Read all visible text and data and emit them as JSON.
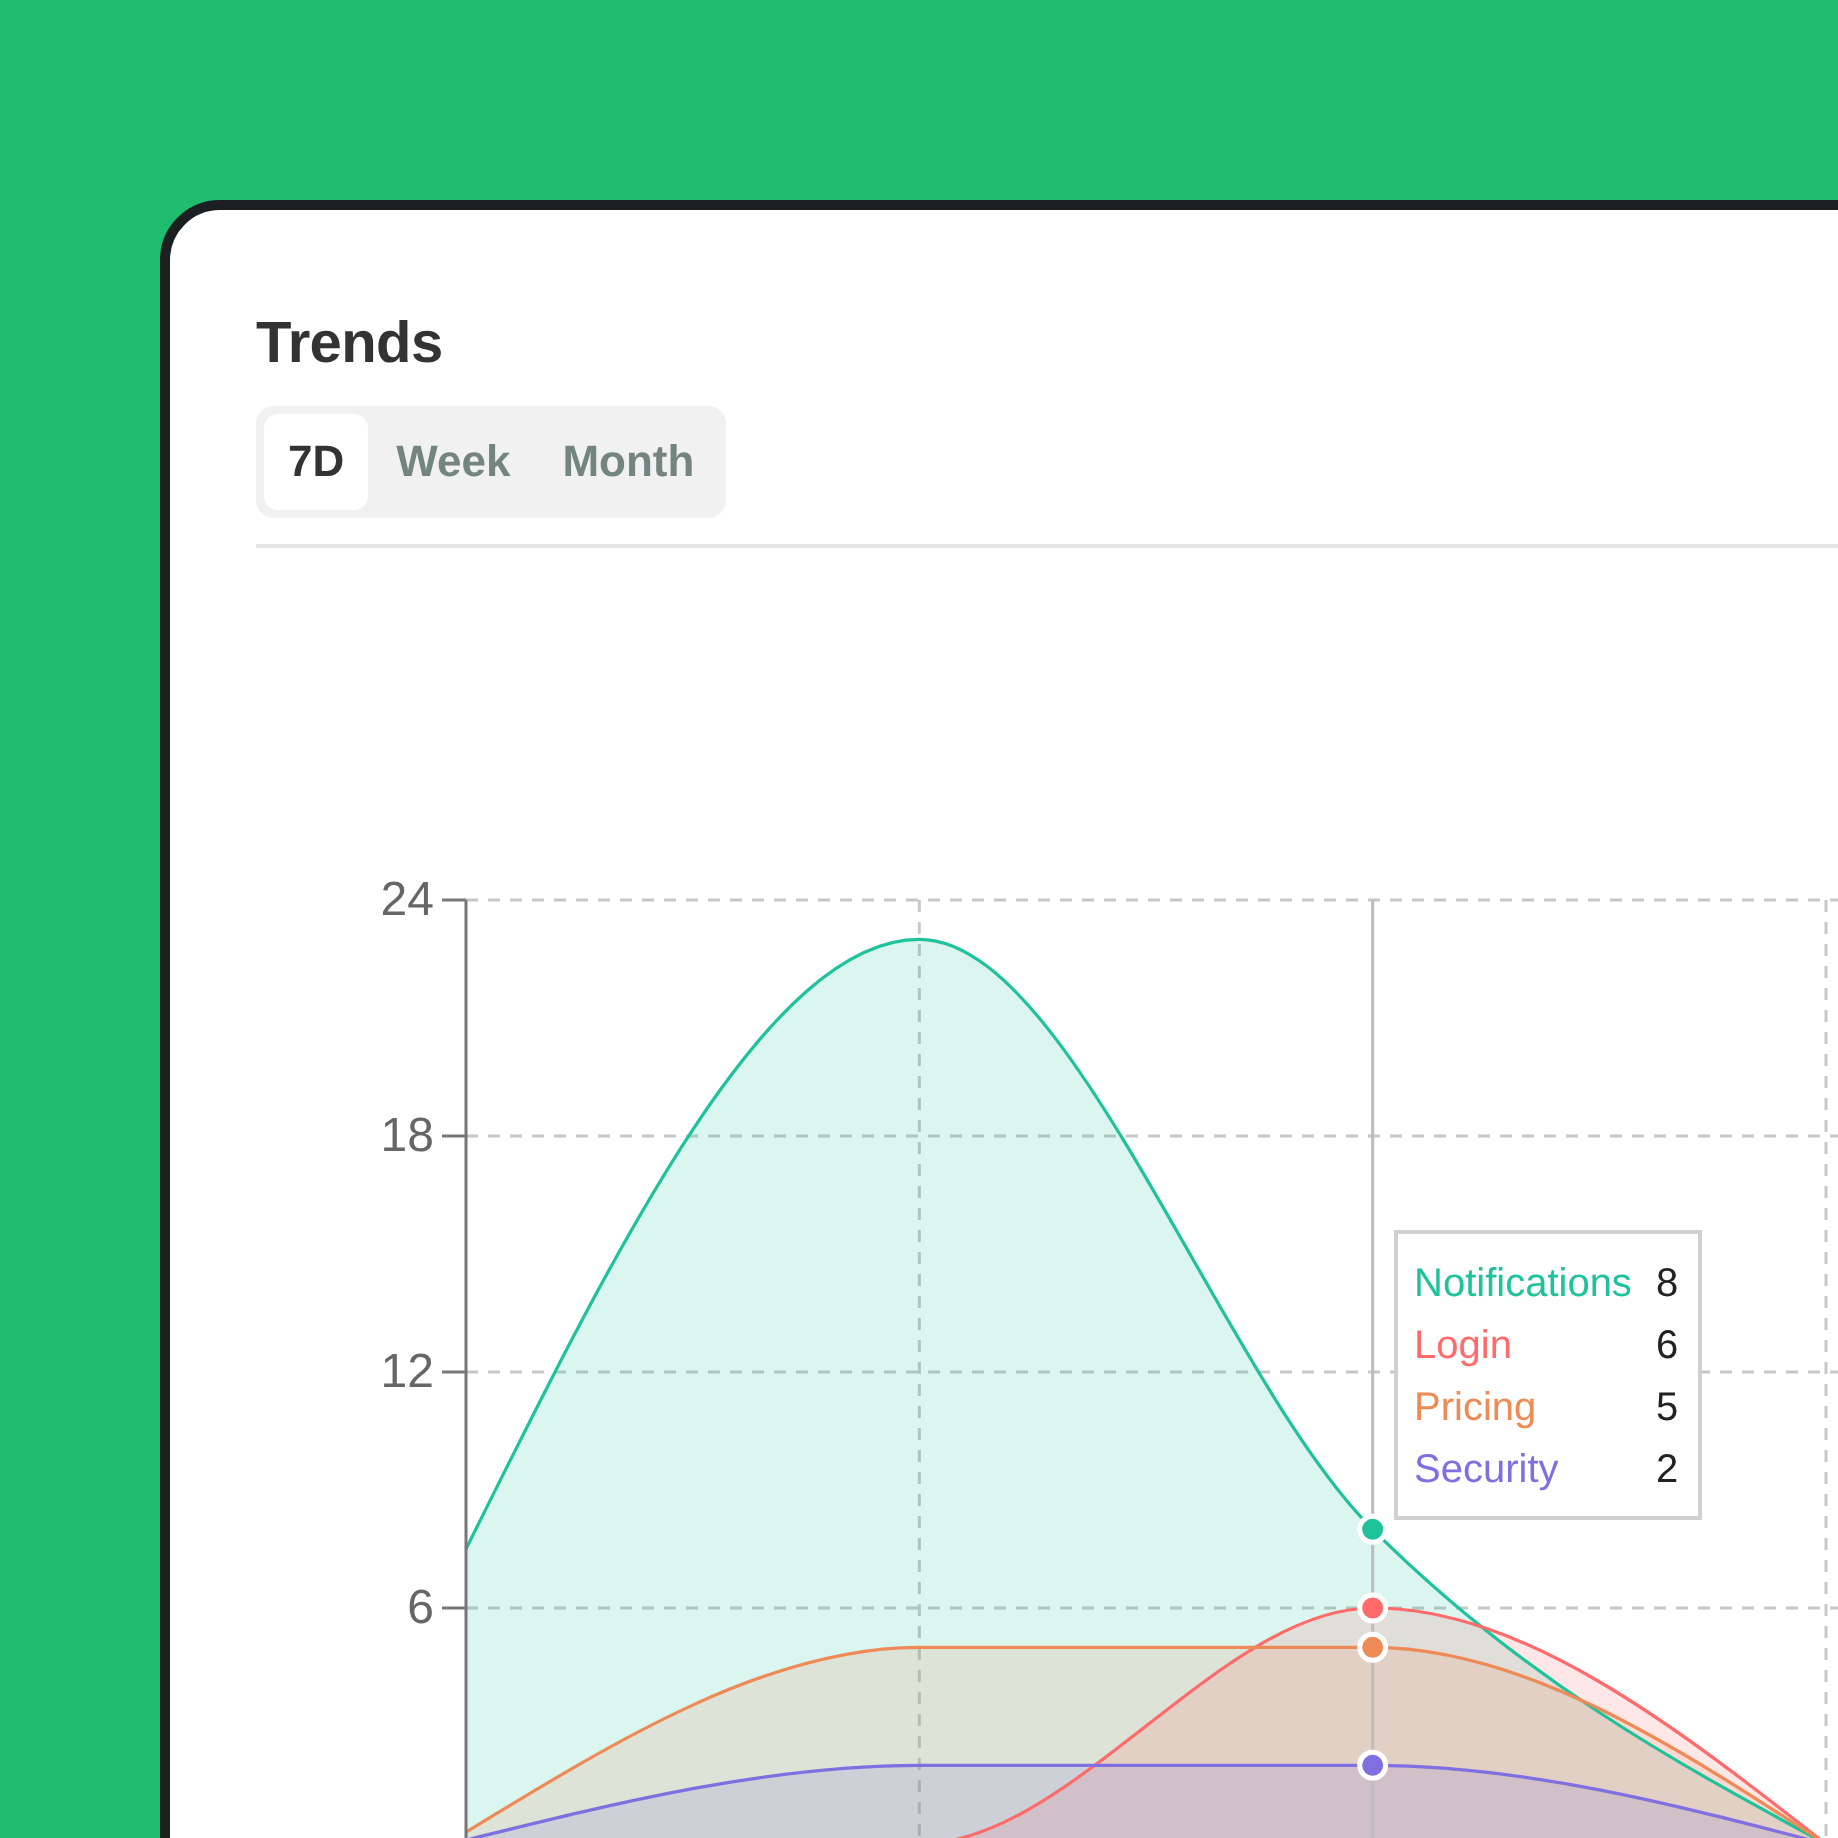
{
  "card": {
    "title": "Trends"
  },
  "tabs": [
    {
      "label": "7D",
      "selected": true
    },
    {
      "label": "Week",
      "selected": false
    },
    {
      "label": "Month",
      "selected": false
    }
  ],
  "chart": {
    "chart_data": {
      "type": "area",
      "stacked": false,
      "grid": true,
      "categories": [
        null,
        null,
        null,
        null
      ],
      "ylim": [
        0,
        24
      ],
      "yticks": [
        6,
        12,
        18,
        24
      ],
      "series": [
        {
          "name": "Notifications",
          "color": "#1ec29b",
          "values": [
            7.5,
            23,
            8,
            0
          ]
        },
        {
          "name": "Login",
          "color": "#ff6b6b",
          "values": [
            0,
            0,
            6,
            0
          ]
        },
        {
          "name": "Pricing",
          "color": "#ee8a55",
          "values": [
            0.3,
            5,
            5,
            0
          ]
        },
        {
          "name": "Security",
          "color": "#7f6fe0",
          "values": [
            0.1,
            2,
            2,
            0
          ]
        }
      ]
    },
    "hover_columns": [
      {
        "selected": false
      },
      {
        "selected": false
      },
      {
        "selected": true
      },
      {
        "selected": false
      }
    ],
    "tooltip": {
      "values": [
        "8",
        "6",
        "5",
        "2"
      ]
    }
  }
}
